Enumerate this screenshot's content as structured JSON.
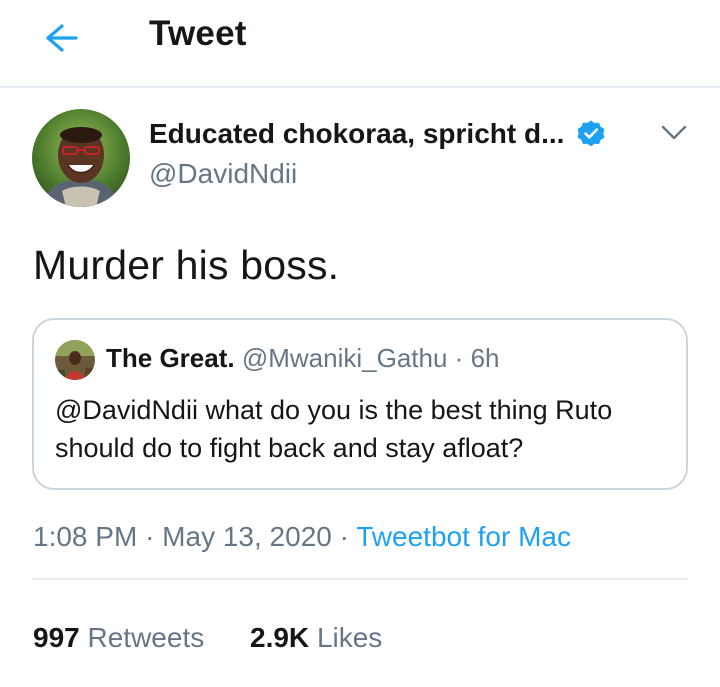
{
  "colors": {
    "accent": "#1da1f2",
    "text_primary": "#14171a",
    "text_secondary": "#657786",
    "border": "#ccd6dd",
    "divider": "#e6ecf0"
  },
  "header": {
    "back_icon": "arrow-left-icon",
    "title": "Tweet"
  },
  "tweet": {
    "author": {
      "avatar_icon": "avatar-photo",
      "name": "Educated chokoraa, spricht d...",
      "verified_icon": "verified-badge-icon",
      "handle": "@DavidNdii"
    },
    "menu_icon": "chevron-down-icon",
    "text": "Murder his boss.",
    "quote": {
      "avatar_icon": "avatar-photo",
      "name": "The Great.",
      "handle": "@Mwaniki_Gathu",
      "separator": "·",
      "time": "6h",
      "text": "@DavidNdii what do you is the best thing Ruto should do to fight back and stay afloat?"
    },
    "meta": {
      "time": "1:08 PM",
      "separator1": "·",
      "date": "May 13, 2020",
      "separator2": "·",
      "source": "Tweetbot for Mac"
    },
    "stats": {
      "retweets_count": "997",
      "retweets_label": "Retweets",
      "likes_count": "2.9K",
      "likes_label": "Likes"
    }
  }
}
